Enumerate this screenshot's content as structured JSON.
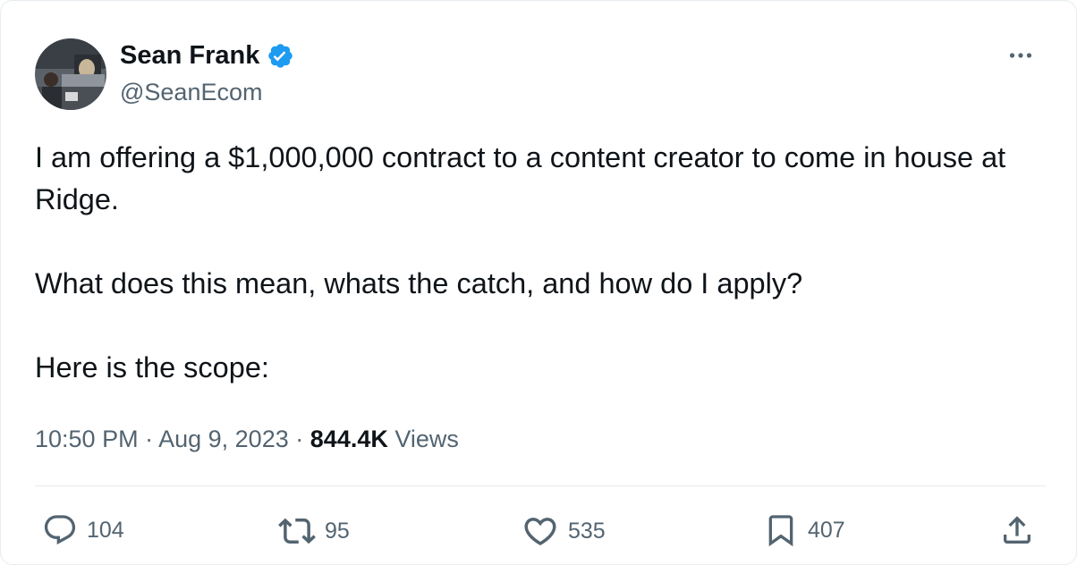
{
  "author": {
    "display_name": "Sean Frank",
    "handle": "@SeanEcom",
    "verified": true,
    "verified_color": "#1d9bf0"
  },
  "tweet": {
    "paragraphs": [
      "I am offering a $1,000,000 contract to a content creator to come in house at Ridge.",
      "What does this mean, whats the catch, and how do I apply?",
      "Here is the scope:"
    ],
    "time": "10:50 PM",
    "date": "Aug 9, 2023",
    "separator": "·",
    "views_count": "844.4K",
    "views_label": "Views"
  },
  "actions": {
    "reply": {
      "icon": "reply-icon",
      "count": "104"
    },
    "retweet": {
      "icon": "retweet-icon",
      "count": "95"
    },
    "like": {
      "icon": "heart-icon",
      "count": "535"
    },
    "bookmark": {
      "icon": "bookmark-icon",
      "count": "407"
    },
    "share": {
      "icon": "share-icon"
    }
  },
  "colors": {
    "text_primary": "#0f1419",
    "text_secondary": "#536471",
    "border": "#e6ecf0"
  }
}
